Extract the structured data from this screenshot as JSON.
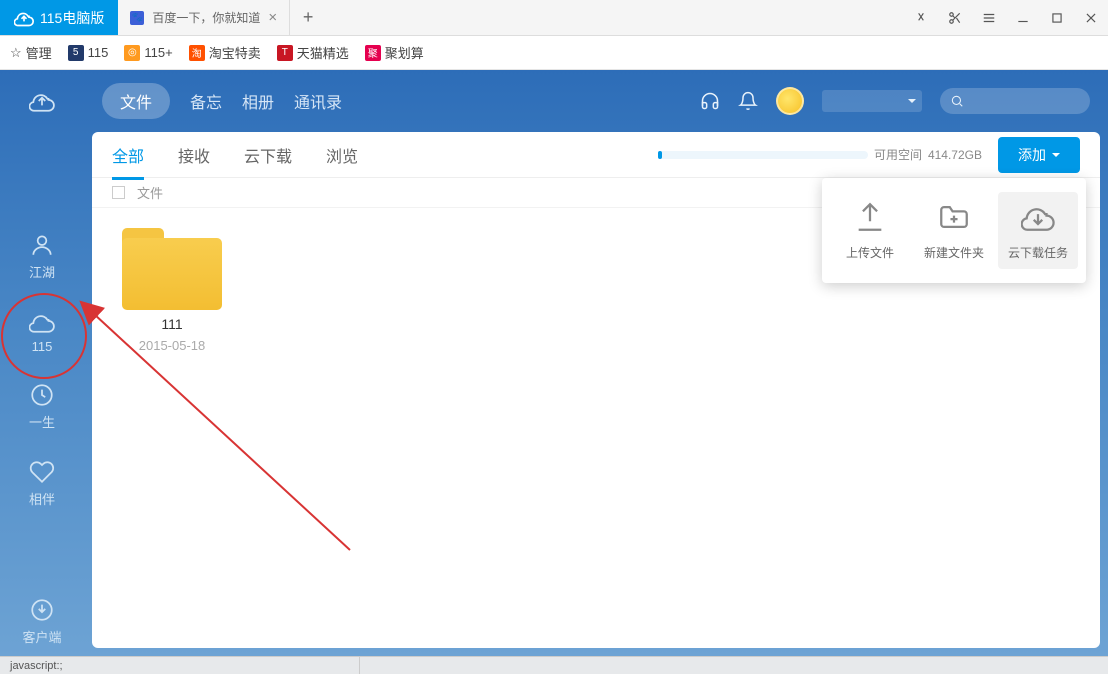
{
  "titlebar": {
    "app_name": "115电脑版",
    "browser_tab_title": "百度一下，你就知道"
  },
  "bookmarks": {
    "manage": "管理",
    "b115": "115",
    "b115plus": "115+",
    "taobao": "淘宝特卖",
    "tmall": "天猫精选",
    "juhuasuan": "聚划算"
  },
  "sidebar": {
    "jianghu": "江湖",
    "s115": "115",
    "yisheng": "一生",
    "xiangban": "相伴",
    "client": "客户端"
  },
  "topnav": {
    "file": "文件",
    "memo": "备忘",
    "album": "相册",
    "contacts": "通讯录"
  },
  "tabs": {
    "all": "全部",
    "receive": "接收",
    "cloud_dl": "云下载",
    "browse": "浏览"
  },
  "space": {
    "label": "可用空间",
    "value": "414.72GB"
  },
  "add_button": "添加",
  "list_header": {
    "file": "文件"
  },
  "folder": {
    "name": "111",
    "date": "2015-05-18"
  },
  "popover": {
    "upload": "上传文件",
    "new_folder": "新建文件夹",
    "cloud_task": "云下载任务"
  },
  "statusbar": {
    "text": "javascript:;"
  }
}
